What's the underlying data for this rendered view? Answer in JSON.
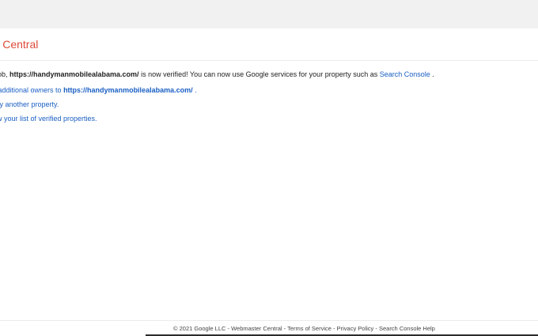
{
  "header": {
    "title": "ter Central"
  },
  "message": {
    "line1_prefix": "t job, ",
    "line1_url": "https://handymanmobilealabama.com/",
    "line1_middle": " is now verified! You can now use Google services for your property such as ",
    "line1_link": "Search Console",
    "line1_suffix": " .",
    "line2_prefix": "ld additional owners to ",
    "line2_url": "https://handymanmobilealabama.com/",
    "line2_suffix": " .",
    "line3": "rify another property.",
    "line4": "ew your list of verified properties."
  },
  "footer": {
    "copyright": "© 2021 Google LLC",
    "links": [
      "Webmaster Central",
      "Terms of Service",
      "Privacy Policy",
      "Search Console Help"
    ],
    "separator": " - "
  }
}
